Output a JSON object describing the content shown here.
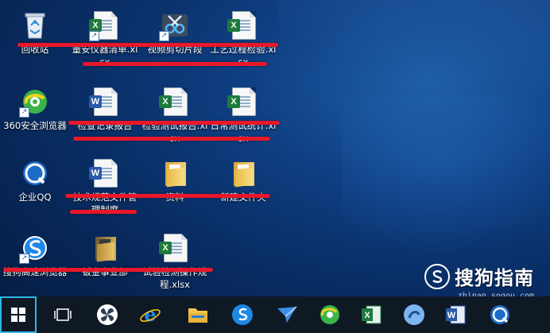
{
  "desktop": {
    "icons": [
      {
        "key": "recycle",
        "label": "回收站"
      },
      {
        "key": "xls1",
        "label": "量安仪器清单.xlsx"
      },
      {
        "key": "video",
        "label": "视频剪切片段"
      },
      {
        "key": "xls2",
        "label": "工艺过程检验.xlsx"
      },
      {
        "key": "browser360",
        "label": "360安全浏览器"
      },
      {
        "key": "doc1",
        "label": "检查记录报告"
      },
      {
        "key": "xls3",
        "label": "检验测试报告.xlsx"
      },
      {
        "key": "xls4",
        "label": "日常测试统计.xlsx"
      },
      {
        "key": "qq",
        "label": "企业QQ"
      },
      {
        "key": "doc2",
        "label": "技术规范文件管理制度"
      },
      {
        "key": "folder1",
        "label": "资料"
      },
      {
        "key": "folder2",
        "label": "新建文件夹"
      },
      {
        "key": "sogou",
        "label": "搜狗高速浏览器"
      },
      {
        "key": "folder3",
        "label": "钣金事业部"
      },
      {
        "key": "xls5",
        "label": "试验检测操作规程.xlsx"
      }
    ]
  },
  "watermark": {
    "brand": "搜狗指南",
    "url": "zhinan.sogou.com"
  },
  "taskbar": {
    "items": [
      {
        "name": "start-button"
      },
      {
        "name": "task-view-button"
      },
      {
        "name": "pinwheel-app-button"
      },
      {
        "name": "internet-explorer-button"
      },
      {
        "name": "file-explorer-button"
      },
      {
        "name": "sogou-browser-button"
      },
      {
        "name": "mail-app-button"
      },
      {
        "name": "browser-360-button"
      },
      {
        "name": "excel-button"
      },
      {
        "name": "sogou-input-button"
      },
      {
        "name": "word-button"
      },
      {
        "name": "qq-button"
      }
    ]
  },
  "colors": {
    "redaction": "#e8182a",
    "taskbar": "#0f1924",
    "start_highlight": "#2fb6e6"
  }
}
